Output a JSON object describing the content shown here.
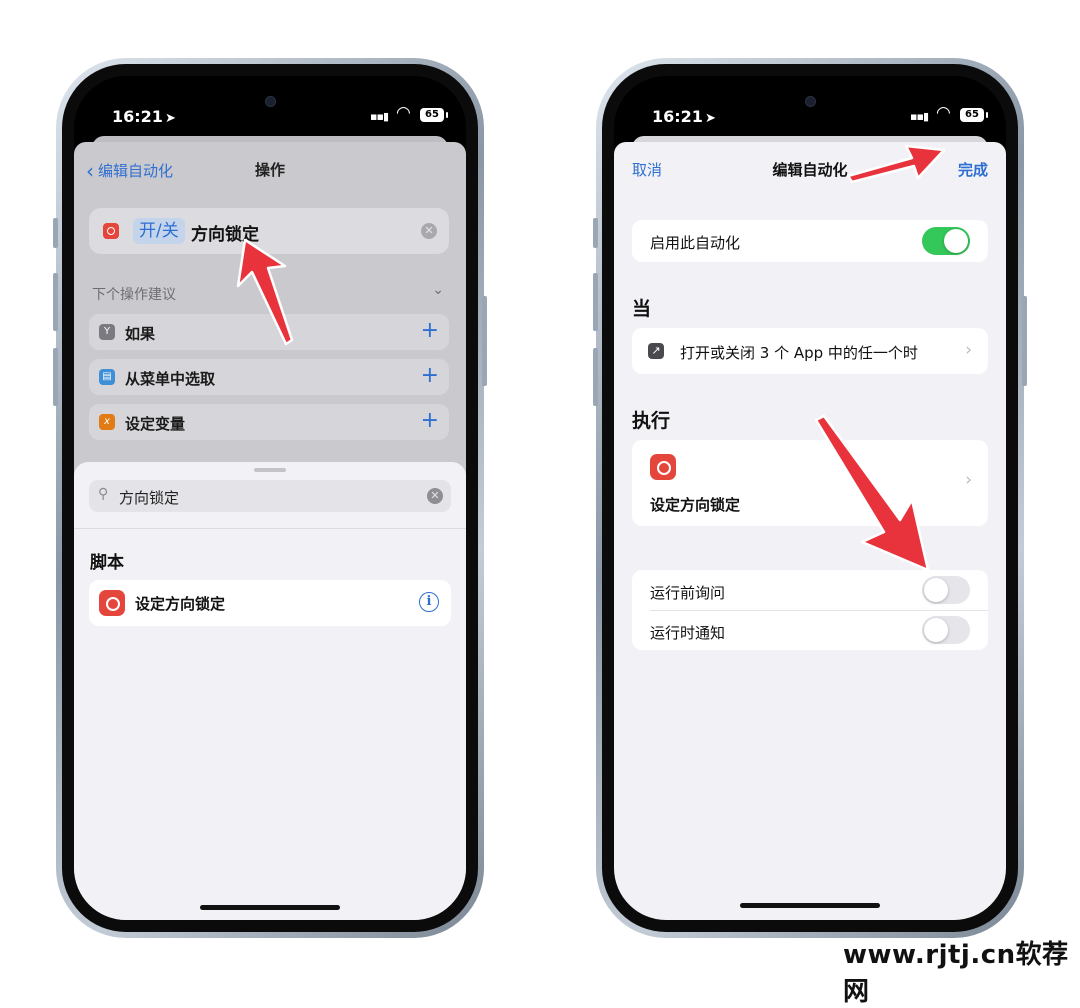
{
  "status_bar": {
    "time": "16:21",
    "location_glyph": "➤",
    "signal_glyph": "▪▪▮",
    "wifi_glyph": "◠",
    "battery": "65"
  },
  "left_screen": {
    "nav": {
      "back_label": "编辑自动化",
      "title": "操作"
    },
    "action": {
      "pill_label": "开/关",
      "text": "方向锁定"
    },
    "suggestions_header": "下个操作建议",
    "suggestions": [
      {
        "label": "如果",
        "icon": "if-icon",
        "color": "#7a7a80",
        "glyph": "Y"
      },
      {
        "label": "从菜单中选取",
        "icon": "menu-icon",
        "color": "#3d8fd6",
        "glyph": "▤"
      },
      {
        "label": "设定变量",
        "icon": "variable-icon",
        "color": "#e07b16",
        "glyph": "x"
      }
    ],
    "search": {
      "query": "方向锁定"
    },
    "section_title": "脚本",
    "script_result": "设定方向锁定"
  },
  "right_screen": {
    "nav": {
      "cancel": "取消",
      "title": "编辑自动化",
      "done": "完成"
    },
    "enable_label": "启用此自动化",
    "enable_on": true,
    "when_title": "当",
    "trigger_text": "打开或关闭 3 个 App 中的任一个时",
    "do_title": "执行",
    "do_action": "设定方向锁定",
    "ask_before_running": "运行前询问",
    "ask_before_running_on": false,
    "notify_when_run": "运行时通知",
    "notify_when_run_on": false
  },
  "watermark": "www.rjtj.cn软荐网",
  "colors": {
    "accent": "#2f6fd1",
    "toggle_on": "#34c759",
    "red": "#e5463c",
    "arrow": "#e8323c"
  }
}
